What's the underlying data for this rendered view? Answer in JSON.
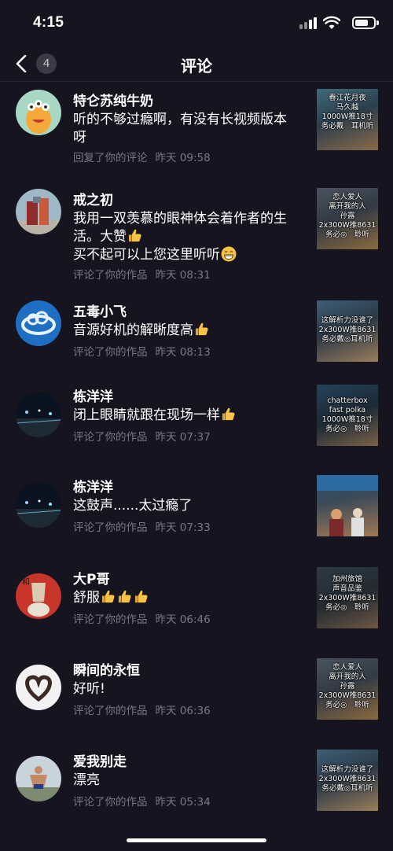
{
  "status_bar": {
    "time": "4:15"
  },
  "nav": {
    "title": "评论",
    "badge": "4"
  },
  "comments": [
    {
      "user": "特仑苏纯牛奶",
      "lines": [
        "听的不够过瘾啊，有没有长视频版本",
        "呀"
      ],
      "action": "回复了你的评论",
      "time": "昨天 09:58",
      "avatar_icon": "monster-avatar",
      "thumb_caption": "春江花月夜\n马久越\n1000W推18寸\n务必戴　耳机听",
      "thumb_colors": [
        "#3f6b7a",
        "#8a6b4a"
      ]
    },
    {
      "user": "戒之初",
      "lines": [
        "我用一双羡慕的眼神体会着作者的生",
        "活。大赞",
        "买不起可以上您这里听听"
      ],
      "action": "评论了你的作品",
      "time": "昨天 08:31",
      "avatar_icon": "book-stack-avatar",
      "thumb_caption": "恋人爱人\n离开我的人\n孙露\n2x300W推8631\n务必◎　聆听",
      "thumb_colors": [
        "#4a5460",
        "#8b6a3e"
      ]
    },
    {
      "user": "五毒小飞",
      "lines": [
        "音源好机的解晰度高"
      ],
      "action": "评论了你的作品",
      "time": "昨天 08:13",
      "avatar_icon": "cloud-avatar",
      "thumb_caption": "这解析力没谁了\n2x300W推8631\n务必戴◎耳机听",
      "thumb_colors": [
        "#3f5f78",
        "#9a7d5c"
      ]
    },
    {
      "user": "栋洋洋",
      "lines": [
        "闭上眼睛就跟在现场一样"
      ],
      "action": "评论了你的作品",
      "time": "昨天 07:37",
      "avatar_icon": "night-road-avatar",
      "thumb_caption": "chatterbox\nfast polka\n1000W推18寸\n务必◎　聆听",
      "thumb_colors": [
        "#24425c",
        "#7b6247"
      ]
    },
    {
      "user": "栋洋洋",
      "lines": [
        "这鼓声......太过瘾了"
      ],
      "action": "评论了你的作品",
      "time": "昨天 07:33",
      "avatar_icon": "night-road-avatar",
      "thumb_caption": "",
      "thumb_colors": [
        "#2c4d6e",
        "#a17855"
      ]
    },
    {
      "user": "大P哥",
      "lines": [
        "舒服"
      ],
      "action": "评论了你的作品",
      "time": "昨天 06:46",
      "avatar_icon": "calligraphy-avatar",
      "thumb_caption": "加州旅馆\n声音品鉴\n2x300W推8631\n务必◎　聆听",
      "thumb_colors": [
        "#2e3a44",
        "#6d5744"
      ]
    },
    {
      "user": "瞬间的永恒",
      "lines": [
        "好听!"
      ],
      "action": "评论了你的作品",
      "time": "昨天 06:36",
      "avatar_icon": "heart-hands-avatar",
      "thumb_caption": "恋人爱人\n离开我的人\n孙露\n2x300W推8631\n务必◎　聆听",
      "thumb_colors": [
        "#4a5460",
        "#8b6a3e"
      ]
    },
    {
      "user": "爱我别走",
      "lines": [
        "漂亮"
      ],
      "action": "评论了你的作品",
      "time": "昨天 05:34",
      "avatar_icon": "swimmer-avatar",
      "thumb_caption": "这解析力没谁了\n2x300W推8631\n务必戴◎耳机听",
      "thumb_colors": [
        "#3f5f78",
        "#9a7d5c"
      ]
    }
  ]
}
